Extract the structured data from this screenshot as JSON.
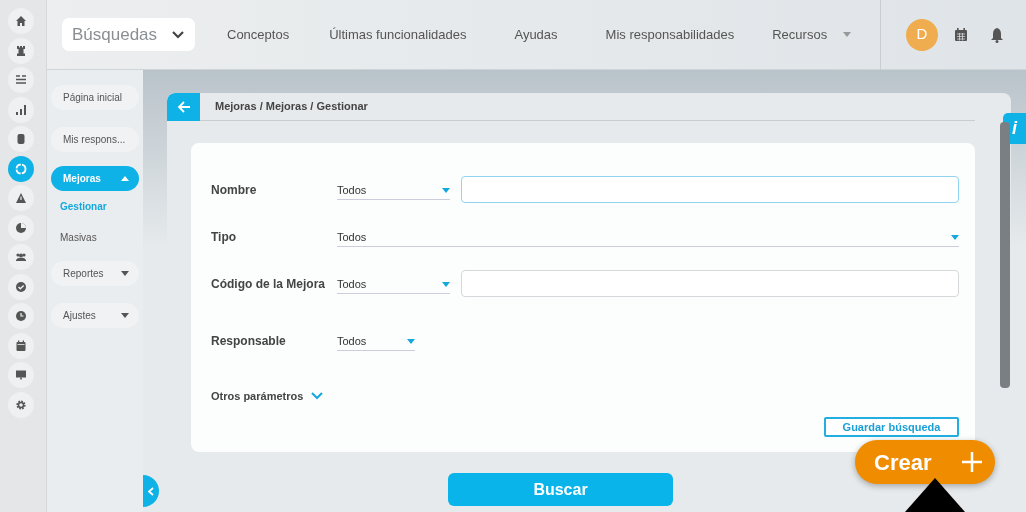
{
  "rail": {
    "items": [
      {
        "selected": false
      },
      {
        "selected": false
      },
      {
        "selected": false
      },
      {
        "selected": false
      },
      {
        "selected": false
      },
      {
        "selected": true
      },
      {
        "selected": false
      },
      {
        "selected": false
      },
      {
        "selected": false
      },
      {
        "selected": false
      },
      {
        "selected": false
      },
      {
        "selected": false
      },
      {
        "selected": false
      },
      {
        "selected": false
      }
    ]
  },
  "topbar": {
    "search_select": "Búsquedas",
    "links": [
      {
        "label": "Conceptos",
        "has_menu": false
      },
      {
        "label": "Últimas funcionalidades",
        "has_menu": false
      },
      {
        "label": "Ayudas",
        "has_menu": false
      },
      {
        "label": "Mis responsabilidades",
        "has_menu": false
      },
      {
        "label": "Recursos",
        "has_menu": true
      }
    ],
    "avatar": "D"
  },
  "sidebar": {
    "items": [
      {
        "label": "Página inicial",
        "selected": false
      },
      {
        "label": "Mis respons...",
        "selected": false
      },
      {
        "label": "Mejoras",
        "selected": true,
        "expanded": true,
        "children": [
          {
            "label": "Gestionar",
            "selected": true
          },
          {
            "label": "Masivas",
            "selected": false
          }
        ]
      },
      {
        "label": "Reportes",
        "selected": false,
        "expanded": false
      },
      {
        "label": "Ajustes",
        "selected": false,
        "expanded": false
      }
    ]
  },
  "breadcrumb": "Mejoras / Mejoras / Gestionar",
  "form": {
    "fields": [
      {
        "label": "Nombre",
        "kind": "select_input",
        "value": "Todos",
        "focused": true
      },
      {
        "label": "Tipo",
        "kind": "select",
        "value": "Todos"
      },
      {
        "label": "Código de la Mejora",
        "kind": "select_input",
        "value": "Todos",
        "focused": false
      },
      {
        "label": "Responsable",
        "kind": "select_short",
        "value": "Todos"
      }
    ],
    "more": "Otros parámetros",
    "save": "Guardar búsqueda"
  },
  "search_button": "Buscar",
  "create_button": "Crear",
  "info_tab": "i"
}
